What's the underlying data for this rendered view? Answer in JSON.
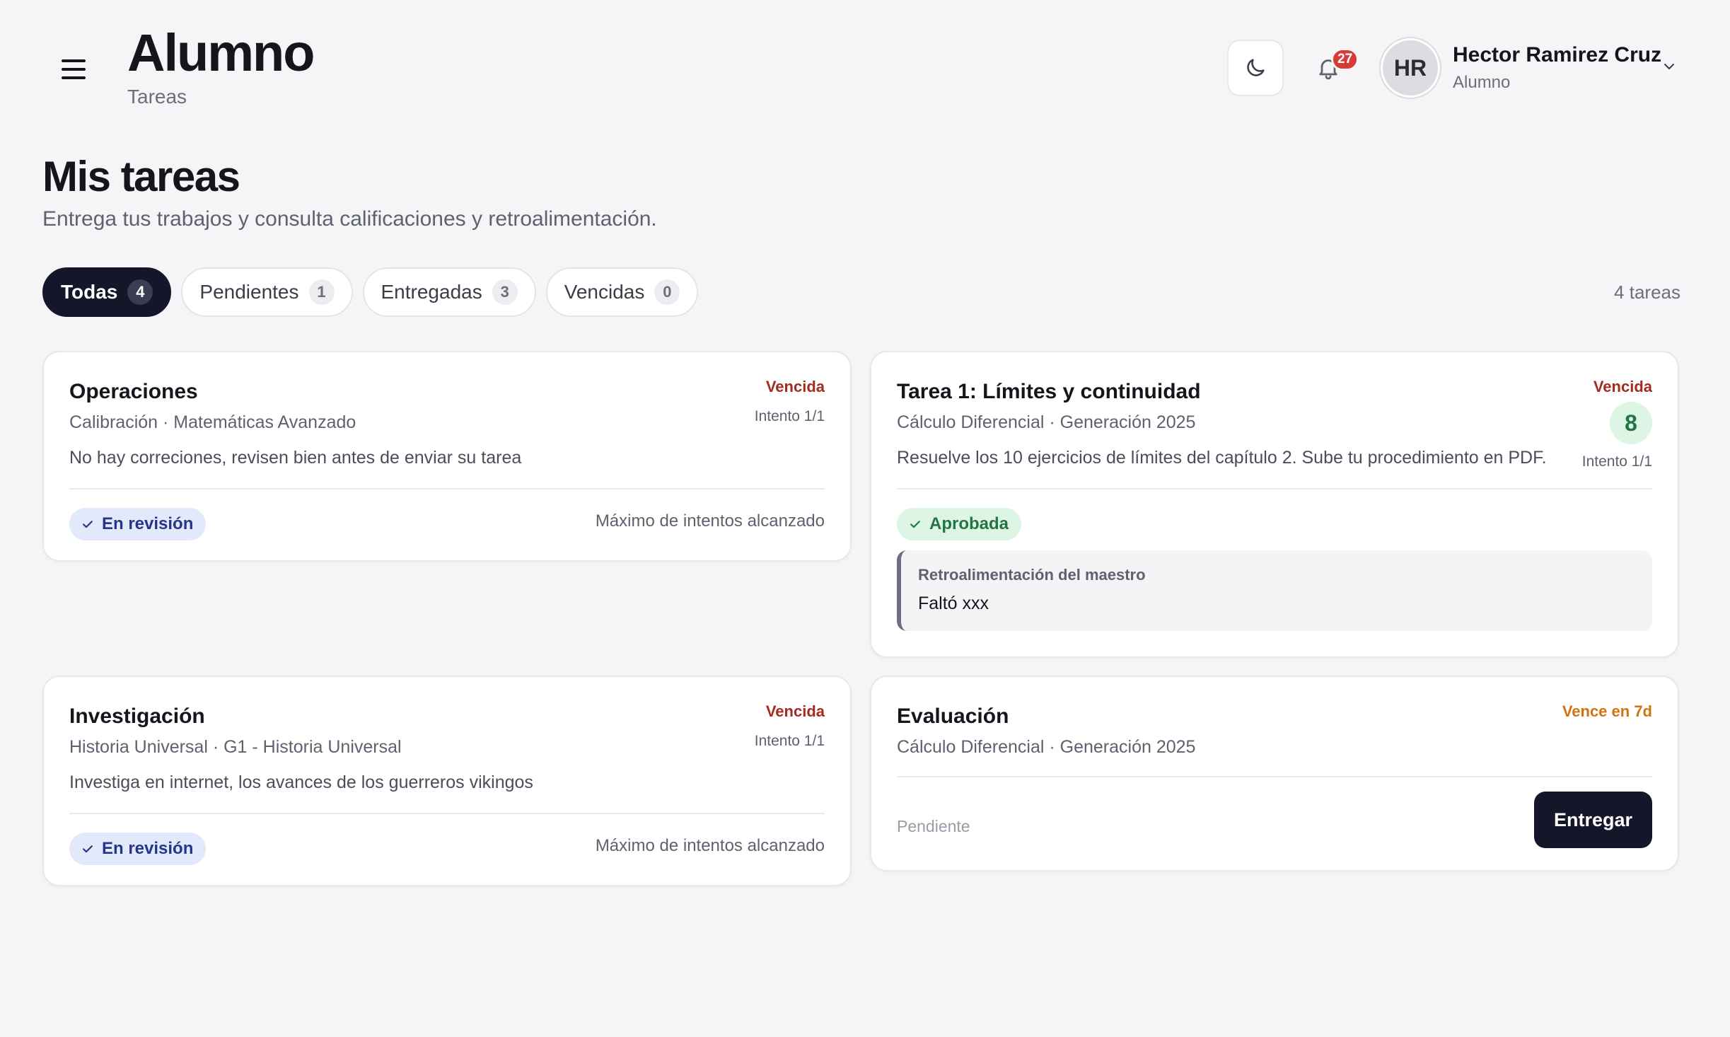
{
  "header": {
    "title": "Alumno",
    "subtitle": "Tareas",
    "notifications_count": "27",
    "user": {
      "initials": "HR",
      "name": "Hector Ramirez Cruz",
      "role": "Alumno"
    }
  },
  "page": {
    "title": "Mis tareas",
    "subtitle": "Entrega tus trabajos y consulta calificaciones y retroalimentación."
  },
  "tabs": [
    {
      "label": "Todas",
      "count": "4"
    },
    {
      "label": "Pendientes",
      "count": "1"
    },
    {
      "label": "Entregadas",
      "count": "3"
    },
    {
      "label": "Vencidas",
      "count": "0"
    }
  ],
  "tasks_total": "4 tareas",
  "tasks": [
    {
      "title": "Operaciones",
      "meta": "Calibración · Matemáticas Avanzado",
      "description": "No hay correciones, revisen bien antes de enviar su tarea",
      "status": "Vencida",
      "attempt": "Intento 1/1",
      "badge": "En revisión",
      "note": "Máximo de intentos alcanzado"
    },
    {
      "title": "Tarea 1: Límites y continuidad",
      "meta": "Cálculo Diferencial · Generación 2025",
      "description": "Resuelve los 10 ejercicios de límites del capítulo 2. Sube tu procedimiento en PDF.",
      "status": "Vencida",
      "grade": "8",
      "attempt": "Intento 1/1",
      "badge": "Aprobada",
      "feedback_label": "Retroalimentación del maestro",
      "feedback_text": "Faltó xxx"
    },
    {
      "title": "Investigación",
      "meta": "Historia Universal · G1 - Historia Universal",
      "description": "Investiga en internet, los avances de los guerreros vikingos",
      "status": "Vencida",
      "attempt": "Intento 1/1",
      "badge": "En revisión",
      "note": "Máximo de intentos alcanzado"
    },
    {
      "title": "Evaluación",
      "meta": "Cálculo Diferencial · Generación 2025",
      "status": "Vence en 7d",
      "pending": "Pendiente",
      "action": "Entregar"
    }
  ],
  "colors": {
    "accent_dark": "#15162a",
    "overdue": "#a32c22",
    "due_soon": "#d47212",
    "approved": "#237543",
    "review": "#26358a",
    "notification": "#d93a36"
  },
  "icons": [
    "menu-icon",
    "moon-icon",
    "bell-icon",
    "chevron-down-icon",
    "check-icon"
  ]
}
